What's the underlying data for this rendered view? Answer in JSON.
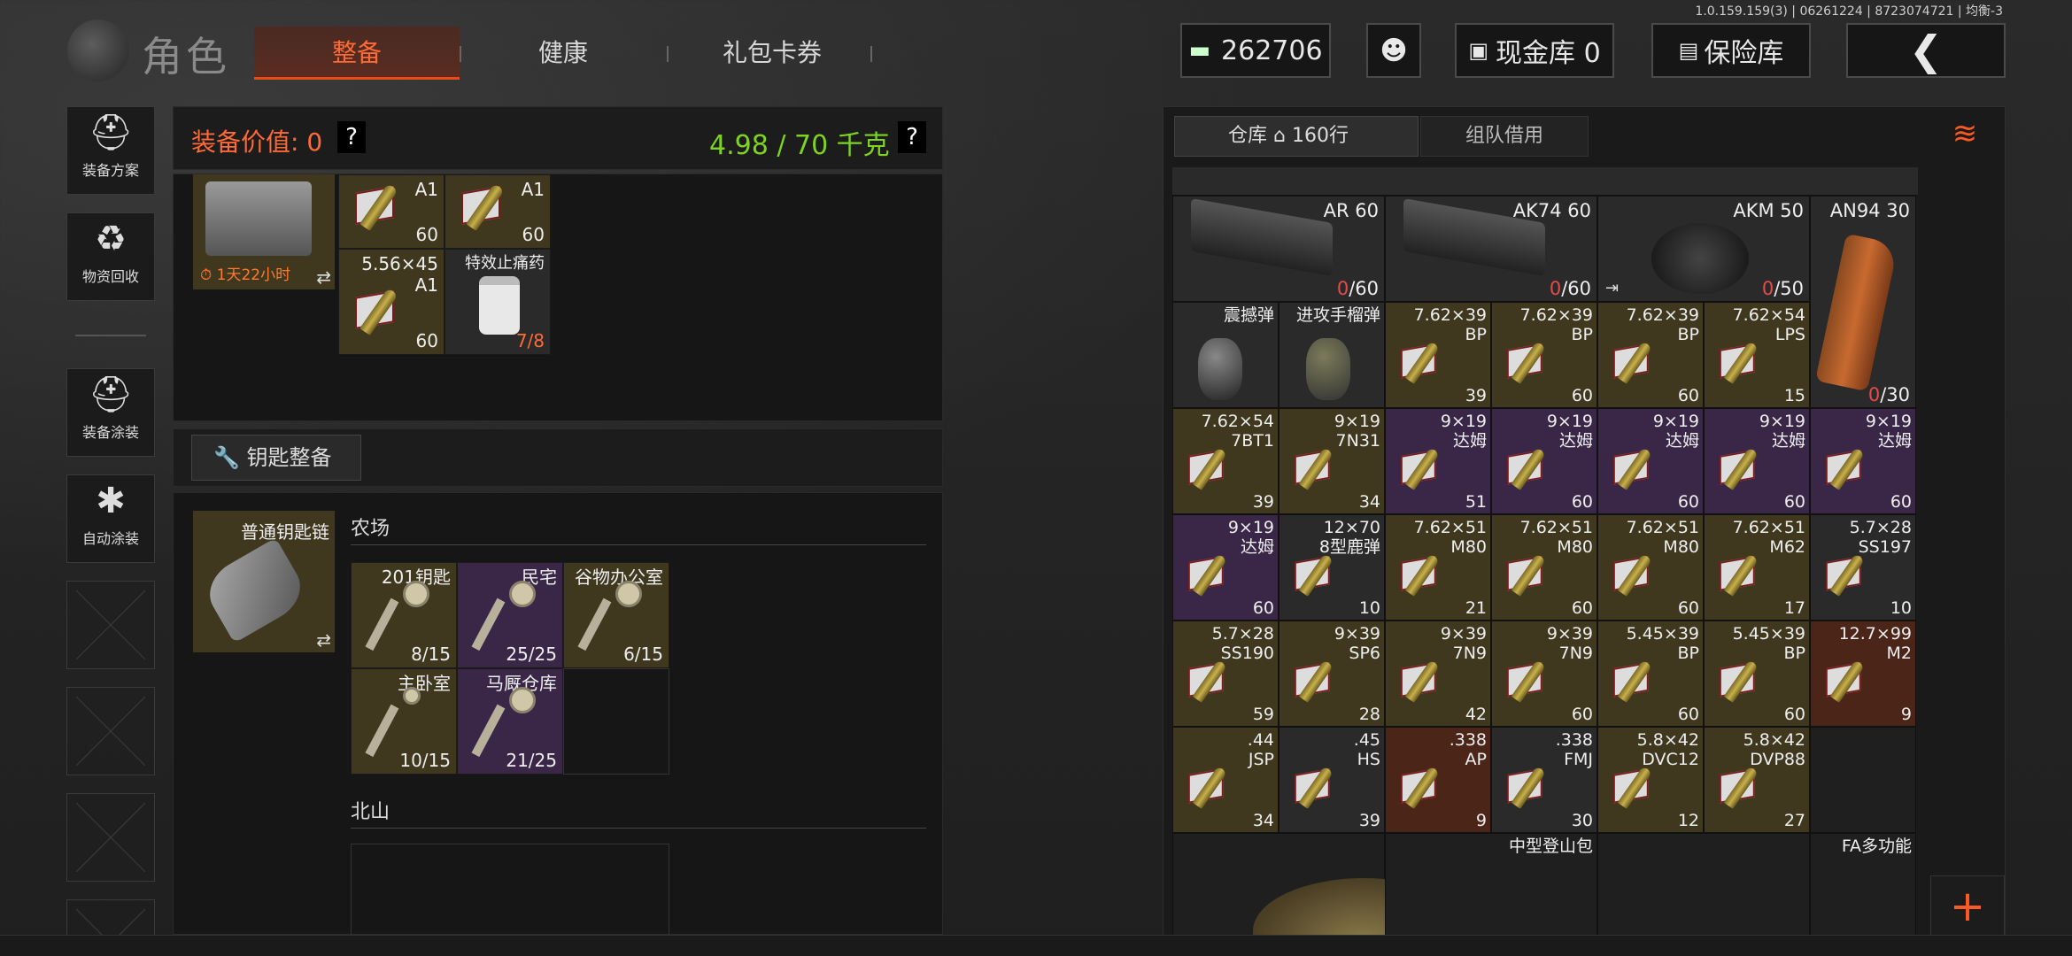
{
  "version": "1.0.159.159(3) | 06261224 | 8723074721 | 均衡-3",
  "title": "角色",
  "tabs": [
    {
      "label": "整备"
    },
    {
      "label": "健康"
    },
    {
      "label": "礼包卡券"
    }
  ],
  "top": {
    "money": "262706",
    "cash_store": "现金库 0",
    "insurance": "保险库",
    "back_icon": "chevron-left-icon"
  },
  "sidebar": [
    {
      "label": "装备方案",
      "icon": "helmet-grid-icon"
    },
    {
      "label": "物资回收",
      "icon": "recycle-face-icon"
    },
    {
      "label": "装备涂装",
      "icon": "helmet-paint-icon"
    },
    {
      "label": "自动涂装",
      "icon": "brush-gear-icon"
    }
  ],
  "equip": {
    "value_label": "装备价值: 0",
    "weight": "4.98 / 70 千克",
    "help": "?",
    "timer": "1天22小时",
    "items": [
      {
        "name": "A1",
        "count": "60"
      },
      {
        "name": "A1",
        "count": "60"
      },
      {
        "name": "5.56×45\nA1",
        "count": "60"
      },
      {
        "name": "特效止痛药",
        "count": "7/8"
      }
    ]
  },
  "key_section": {
    "button": "钥匙整备",
    "chain": "普通钥匙链",
    "group1": "农场",
    "group2": "北山",
    "keys": [
      {
        "name": "201钥匙",
        "count": "8/15"
      },
      {
        "name": "民宅",
        "count": "25/25"
      },
      {
        "name": "谷物办公室",
        "count": "6/15"
      },
      {
        "name": "主卧室",
        "count": "10/15"
      },
      {
        "name": "马厩仓库",
        "count": "21/25"
      }
    ]
  },
  "warehouse": {
    "tab1": "仓库",
    "tab1_rows": "160行",
    "tab2": "组队借用",
    "mags": [
      {
        "name": "AR 60",
        "count_red": "0",
        "count": "/60"
      },
      {
        "name": "AK74 60",
        "count_red": "0",
        "count": "/60"
      },
      {
        "name": "AKM 50",
        "count_red": "0",
        "count": "/50"
      },
      {
        "name": "AN94 30",
        "count_red": "0",
        "count": "/30"
      }
    ],
    "row1": [
      {
        "name": "震撼弹",
        "count": ""
      },
      {
        "name": "进攻手榴弹",
        "count": ""
      },
      {
        "name": "7.62×39\nBP",
        "count": "39"
      },
      {
        "name": "7.62×39\nBP",
        "count": "60"
      },
      {
        "name": "7.62×39\nBP",
        "count": "60"
      },
      {
        "name": "7.62×54\nLPS",
        "count": "15"
      }
    ],
    "row2": [
      {
        "name": "7.62×54\n7BT1",
        "count": "39"
      },
      {
        "name": "9×19\n7N31",
        "count": "34"
      },
      {
        "name": "9×19\n达姆",
        "count": "51"
      },
      {
        "name": "9×19\n达姆",
        "count": "60"
      },
      {
        "name": "9×19\n达姆",
        "count": "60"
      },
      {
        "name": "9×19\n达姆",
        "count": "60"
      },
      {
        "name": "9×19\n达姆",
        "count": "60"
      }
    ],
    "row3": [
      {
        "name": "9×19\n达姆",
        "count": "60"
      },
      {
        "name": "12×70\n8型鹿弹",
        "count": "10"
      },
      {
        "name": "7.62×51\nM80",
        "count": "21"
      },
      {
        "name": "7.62×51\nM80",
        "count": "60"
      },
      {
        "name": "7.62×51\nM80",
        "count": "60"
      },
      {
        "name": "7.62×51\nM62",
        "count": "17"
      },
      {
        "name": "5.7×28\nSS197",
        "count": "10"
      }
    ],
    "row4": [
      {
        "name": "5.7×28\nSS190",
        "count": "59"
      },
      {
        "name": "9×39\nSP6",
        "count": "28"
      },
      {
        "name": "9×39\n7N9",
        "count": "42"
      },
      {
        "name": "9×39\n7N9",
        "count": "60"
      },
      {
        "name": "5.45×39\nBP",
        "count": "60"
      },
      {
        "name": "5.45×39\nBP",
        "count": "60"
      },
      {
        "name": "12.7×99\nM2",
        "count": "9"
      }
    ],
    "row5": [
      {
        "name": ".44\nJSP",
        "count": "34"
      },
      {
        "name": ".45\nHS",
        "count": "39"
      },
      {
        "name": ".338\nAP",
        "count": "9"
      },
      {
        "name": ".338\nFMJ",
        "count": "30"
      },
      {
        "name": "5.8×42\nDVC12",
        "count": "12"
      },
      {
        "name": "5.8×42\nDVP88",
        "count": "27"
      }
    ],
    "bottom": [
      {
        "name": "中型登山包"
      },
      {
        "name": "FA多功能"
      }
    ],
    "plus": "+"
  },
  "colors": {
    "accent": "#ff6a36",
    "weight": "#7ed321",
    "gold": "#3f381f",
    "purple": "#3a2647",
    "red_item": "#4a2518"
  }
}
